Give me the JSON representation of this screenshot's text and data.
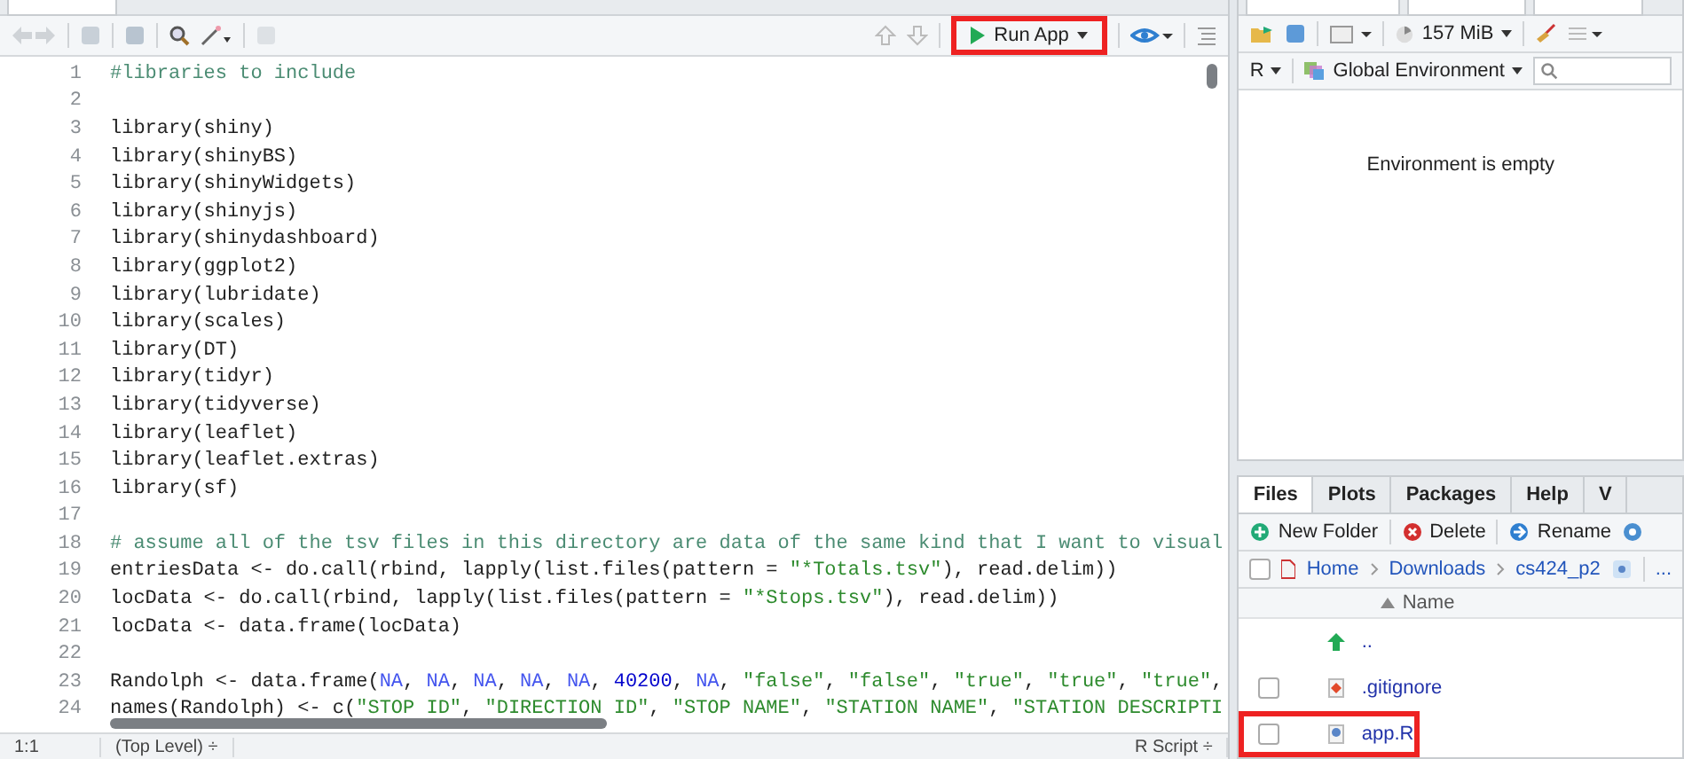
{
  "editor": {
    "toolbar": {
      "run_button": {
        "label": "Run App",
        "highlighted": true
      }
    },
    "lines": [
      {
        "number": "1",
        "segments": [
          {
            "kind": "comment",
            "text": "#libraries to include"
          }
        ]
      },
      {
        "number": "2"
      },
      {
        "number": "3",
        "segments": [
          {
            "kind": "plain",
            "text": "library(shiny)"
          }
        ]
      },
      {
        "number": "4",
        "segments": [
          {
            "kind": "plain",
            "text": "library(shinyBS)"
          }
        ]
      },
      {
        "number": "5",
        "segments": [
          {
            "kind": "plain",
            "text": "library(shinyWidgets)"
          }
        ]
      },
      {
        "number": "6",
        "segments": [
          {
            "kind": "plain",
            "text": "library(shinyjs)"
          }
        ]
      },
      {
        "number": "7",
        "segments": [
          {
            "kind": "plain",
            "text": "library(shinydashboard)"
          }
        ]
      },
      {
        "number": "8",
        "segments": [
          {
            "kind": "plain",
            "text": "library(ggplot2)"
          }
        ]
      },
      {
        "number": "9",
        "segments": [
          {
            "kind": "plain",
            "text": "library(lubridate)"
          }
        ]
      },
      {
        "number": "10",
        "segments": [
          {
            "kind": "plain",
            "text": "library(scales)"
          }
        ]
      },
      {
        "number": "11",
        "segments": [
          {
            "kind": "plain",
            "text": "library(DT)"
          }
        ]
      },
      {
        "number": "12",
        "segments": [
          {
            "kind": "plain",
            "text": "library(tidyr)"
          }
        ]
      },
      {
        "number": "13",
        "segments": [
          {
            "kind": "plain",
            "text": "library(tidyverse)"
          }
        ]
      },
      {
        "number": "14",
        "segments": [
          {
            "kind": "plain",
            "text": "library(leaflet)"
          }
        ]
      },
      {
        "number": "15",
        "segments": [
          {
            "kind": "plain",
            "text": "library(leaflet.extras)"
          }
        ]
      },
      {
        "number": "16",
        "segments": [
          {
            "kind": "plain",
            "text": "library(sf)"
          }
        ]
      },
      {
        "number": "17"
      },
      {
        "number": "18",
        "segments": [
          {
            "kind": "comment",
            "text": "# assume all of the tsv files in this directory are data of the same kind that I want to visual"
          }
        ]
      },
      {
        "number": "19",
        "segments": [
          {
            "kind": "plain",
            "text": "entriesData <- do.call(rbind, lapply(list.files(pattern = "
          },
          {
            "kind": "string",
            "text": "\"*Totals.tsv\""
          },
          {
            "kind": "plain",
            "text": "), read.delim))"
          }
        ]
      },
      {
        "number": "20",
        "segments": [
          {
            "kind": "plain",
            "text": "locData <- do.call(rbind, lapply(list.files(pattern = "
          },
          {
            "kind": "string",
            "text": "\"*Stops.tsv\""
          },
          {
            "kind": "plain",
            "text": "), read.delim))"
          }
        ]
      },
      {
        "number": "21",
        "segments": [
          {
            "kind": "plain",
            "text": "locData <- data.frame(locData)"
          }
        ]
      },
      {
        "number": "22"
      },
      {
        "number": "23",
        "segments": [
          {
            "kind": "plain",
            "text": "Randolph <- data.frame("
          },
          {
            "kind": "constant",
            "text": "NA"
          },
          {
            "kind": "plain",
            "text": ", "
          },
          {
            "kind": "constant",
            "text": "NA"
          },
          {
            "kind": "plain",
            "text": ", "
          },
          {
            "kind": "constant",
            "text": "NA"
          },
          {
            "kind": "plain",
            "text": ", "
          },
          {
            "kind": "constant",
            "text": "NA"
          },
          {
            "kind": "plain",
            "text": ", "
          },
          {
            "kind": "constant",
            "text": "NA"
          },
          {
            "kind": "plain",
            "text": ", "
          },
          {
            "kind": "number",
            "text": "40200"
          },
          {
            "kind": "plain",
            "text": ", "
          },
          {
            "kind": "constant",
            "text": "NA"
          },
          {
            "kind": "plain",
            "text": ", "
          },
          {
            "kind": "string",
            "text": "\"false\""
          },
          {
            "kind": "plain",
            "text": ", "
          },
          {
            "kind": "string",
            "text": "\"false\""
          },
          {
            "kind": "plain",
            "text": ", "
          },
          {
            "kind": "string",
            "text": "\"true\""
          },
          {
            "kind": "plain",
            "text": ", "
          },
          {
            "kind": "string",
            "text": "\"true\""
          },
          {
            "kind": "plain",
            "text": ", "
          },
          {
            "kind": "string",
            "text": "\"true\""
          },
          {
            "kind": "plain",
            "text": ","
          }
        ]
      },
      {
        "number": "24",
        "segments": [
          {
            "kind": "plain",
            "text": "names(Randolph) <- c("
          },
          {
            "kind": "string",
            "text": "\"STOP ID\""
          },
          {
            "kind": "plain",
            "text": ", "
          },
          {
            "kind": "string",
            "text": "\"DIRECTION ID\""
          },
          {
            "kind": "plain",
            "text": ", "
          },
          {
            "kind": "string",
            "text": "\"STOP NAME\""
          },
          {
            "kind": "plain",
            "text": ", "
          },
          {
            "kind": "string",
            "text": "\"STATION NAME\""
          },
          {
            "kind": "plain",
            "text": ", "
          },
          {
            "kind": "string",
            "text": "\"STATION DESCRIPTI"
          }
        ]
      }
    ],
    "status_bar": {
      "position": "1:1",
      "scope": "(Top Level) ÷",
      "file_type": "R Script ÷"
    }
  },
  "environment": {
    "memory": "157 MiB",
    "language": "R",
    "scope": "Global Environment",
    "message": "Environment is empty"
  },
  "files": {
    "tabs": [
      {
        "label": "Files",
        "selected": true
      },
      {
        "label": "Plots",
        "selected": false
      },
      {
        "label": "Packages",
        "selected": false
      },
      {
        "label": "Help",
        "selected": false
      },
      {
        "label": "V",
        "selected": false
      }
    ],
    "actions": [
      "New Folder",
      "Delete",
      "Rename"
    ],
    "select_all": {
      "checked": false
    },
    "breadcrumb": [
      "Home",
      "Downloads",
      "cs424_p2"
    ],
    "more": "...",
    "column": "Name",
    "rows": [
      {
        "kind": "parent",
        "name": "..",
        "highlighted": false
      },
      {
        "kind": "git",
        "name": ".gitignore",
        "highlighted": false,
        "checked": false
      },
      {
        "kind": "rfile",
        "name": "app.R",
        "highlighted": true,
        "checked": false
      }
    ]
  }
}
